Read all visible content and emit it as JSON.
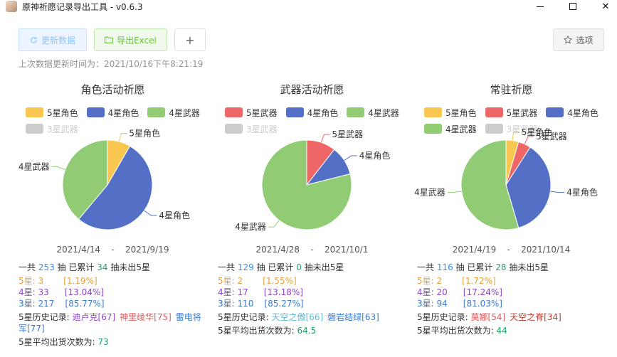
{
  "window": {
    "title": "原神祈愿记录导出工具 - v0.6.3",
    "minimize_glyph": "minimize-icon",
    "maximize_glyph": "maximize-icon",
    "close_glyph": "✕"
  },
  "toolbar": {
    "refresh_label": "更新数据",
    "export_label": "导出Excel",
    "add_label": "+",
    "options_label": "选项",
    "refresh_icon": "refresh-icon",
    "export_icon": "folder-icon",
    "options_icon": "star-icon"
  },
  "colors": {
    "five_char": "#f9c74f",
    "five_weapon": "#ef6666",
    "four_char": "#5470c6",
    "four_weapon": "#91cc75",
    "three_weapon": "#cccccc"
  },
  "update_time": "上次数据更新时间为：2021/10/16下午8:21:19",
  "pools": [
    {
      "title": "角色活动祈愿",
      "legend": [
        {
          "label": "5星角色",
          "color": "#f9c74f",
          "dim": false
        },
        {
          "label": "4星角色",
          "color": "#5470c6",
          "dim": false
        },
        {
          "label": "4星武器",
          "color": "#91cc75",
          "dim": false
        },
        {
          "label": "3星武器",
          "color": "#cccccc",
          "dim": true
        }
      ],
      "chart_data": {
        "type": "pie",
        "slices": [
          {
            "label": "5星角色",
            "value": 3,
            "color": "#f9c74f"
          },
          {
            "label": "4星角色",
            "value": 19,
            "color": "#5470c6"
          },
          {
            "label": "4星武器",
            "value": 14,
            "color": "#91cc75"
          }
        ]
      },
      "date_start": "2021/4/14",
      "date_sep": "-",
      "date_end": "2021/9/19",
      "summary": {
        "prefix": "一共",
        "total": "253",
        "mid": "抽 已累计",
        "pity": "34",
        "suffix": "抽未出5星"
      },
      "rows": [
        {
          "label": "5星:",
          "count": "3",
          "pct": "[1.19%]"
        },
        {
          "label": "4星:",
          "count": "33",
          "pct": "[13.04%]"
        },
        {
          "label": "3星:",
          "count": "217",
          "pct": "[85.77%]"
        }
      ],
      "history_label": "5星历史记录:",
      "history": [
        {
          "text": "迪卢克[67]",
          "color": "#8e44c9"
        },
        {
          "text": "神里绫华[75]",
          "color": "#e05a5a"
        },
        {
          "text": "雷电将军[77]",
          "color": "#3a7bd5"
        }
      ],
      "avg_label": "5星平均出货次数为:",
      "avg": "73"
    },
    {
      "title": "武器活动祈愿",
      "legend": [
        {
          "label": "5星武器",
          "color": "#ef6666",
          "dim": false
        },
        {
          "label": "4星角色",
          "color": "#5470c6",
          "dim": false
        },
        {
          "label": "4星武器",
          "color": "#91cc75",
          "dim": false
        },
        {
          "label": "3星武器",
          "color": "#cccccc",
          "dim": true
        }
      ],
      "chart_data": {
        "type": "pie",
        "slices": [
          {
            "label": "5星武器",
            "value": 2,
            "color": "#ef6666"
          },
          {
            "label": "4星角色",
            "value": 2,
            "color": "#5470c6"
          },
          {
            "label": "4星武器",
            "value": 15,
            "color": "#91cc75"
          }
        ]
      },
      "date_start": "2021/4/28",
      "date_sep": "-",
      "date_end": "2021/10/1",
      "summary": {
        "prefix": "一共",
        "total": "129",
        "mid": "抽 已累计",
        "pity": "0",
        "suffix": "抽未出5星"
      },
      "rows": [
        {
          "label": "5星:",
          "count": "2",
          "pct": "[1.55%]"
        },
        {
          "label": "4星:",
          "count": "17",
          "pct": "[13.18%]"
        },
        {
          "label": "3星:",
          "count": "110",
          "pct": "[85.27%]"
        }
      ],
      "history_label": "5星历史记录:",
      "history": [
        {
          "text": "天空之傲[66]",
          "color": "#5bbcd6"
        },
        {
          "text": "磐岩结绿[63]",
          "color": "#3a7bd5"
        }
      ],
      "avg_label": "5星平均出货次数为:",
      "avg": "64.5"
    },
    {
      "title": "常驻祈愿",
      "legend": [
        {
          "label": "5星角色",
          "color": "#f9c74f",
          "dim": false
        },
        {
          "label": "5星武器",
          "color": "#ef6666",
          "dim": false
        },
        {
          "label": "4星角色",
          "color": "#5470c6",
          "dim": false
        },
        {
          "label": "4星武器",
          "color": "#91cc75",
          "dim": false
        },
        {
          "label": "3星武器",
          "color": "#cccccc",
          "dim": true
        }
      ],
      "chart_data": {
        "type": "pie",
        "slices": [
          {
            "label": "5星角色",
            "value": 1,
            "color": "#f9c74f"
          },
          {
            "label": "5星武器",
            "value": 1,
            "color": "#ef6666"
          },
          {
            "label": "4星角色",
            "value": 8,
            "color": "#5470c6"
          },
          {
            "label": "4星武器",
            "value": 12,
            "color": "#91cc75"
          }
        ]
      },
      "date_start": "2021/4/19",
      "date_sep": "-",
      "date_end": "2021/10/14",
      "summary": {
        "prefix": "一共",
        "total": "116",
        "mid": "抽 已累计",
        "pity": "28",
        "suffix": "抽未出5星"
      },
      "rows": [
        {
          "label": "5星:",
          "count": "2",
          "pct": "[1.72%]"
        },
        {
          "label": "4星:",
          "count": "20",
          "pct": "[17.24%]"
        },
        {
          "label": "3星:",
          "count": "94",
          "pct": "[81.03%]"
        }
      ],
      "history_label": "5星历史记录:",
      "history": [
        {
          "text": "莫娜[54]",
          "color": "#e05a5a"
        },
        {
          "text": "天空之脊[34]",
          "color": "#c0392b"
        }
      ],
      "avg_label": "5星平均出货次数为:",
      "avg": "44"
    }
  ]
}
